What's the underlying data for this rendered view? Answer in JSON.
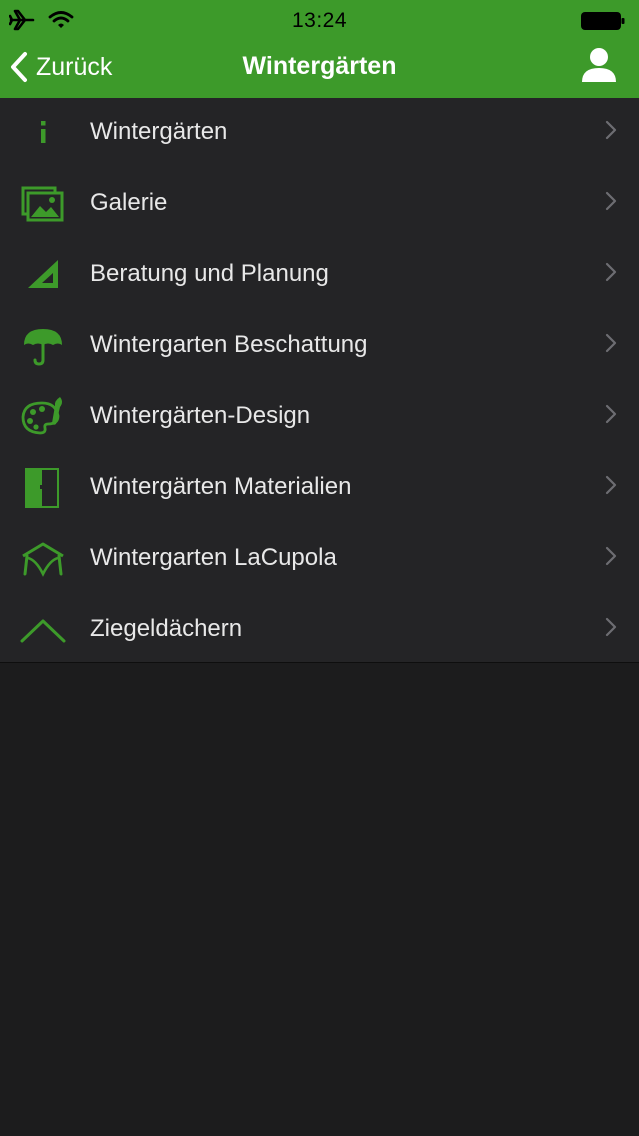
{
  "status_bar": {
    "time": "13:24"
  },
  "nav": {
    "back_label": "Zurück",
    "title": "Wintergärten"
  },
  "colors": {
    "accent": "#3d9a2a",
    "icon_green": "#3d9a2a",
    "list_background": "#242426",
    "page_background": "#1c1c1d"
  },
  "menu": {
    "items": [
      {
        "label": "Wintergärten",
        "icon": "info-icon"
      },
      {
        "label": "Galerie",
        "icon": "gallery-icon"
      },
      {
        "label": "Beratung und Planung",
        "icon": "triangle-ruler-icon"
      },
      {
        "label": "Wintergarten Beschattung",
        "icon": "umbrella-icon"
      },
      {
        "label": "Wintergärten-Design",
        "icon": "palette-icon"
      },
      {
        "label": "Wintergärten Materialien",
        "icon": "material-panel-icon"
      },
      {
        "label": "Wintergarten LaCupola",
        "icon": "cupola-icon"
      },
      {
        "label": "Ziegeldächern",
        "icon": "roof-icon"
      }
    ]
  }
}
